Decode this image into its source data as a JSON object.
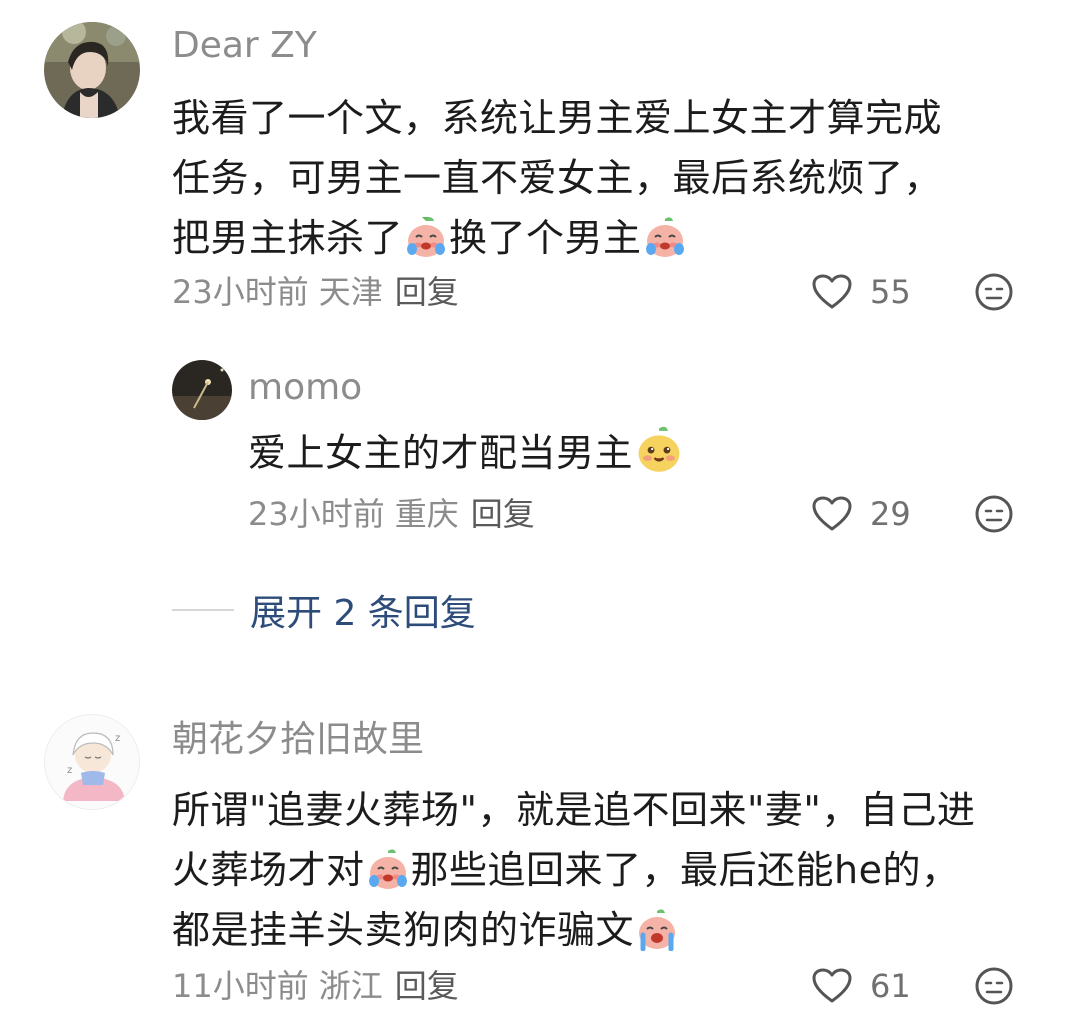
{
  "comments": [
    {
      "username": "Dear ZY",
      "lines": [
        "我看了一个文，系统让男主爱上女主才算完成",
        "任务，可男主一直不爱女主，最后系统烦了，"
      ],
      "line3_a": "把男主抹杀了",
      "line3_b": "换了个男主",
      "time": "23小时前",
      "location": "天津",
      "reply": "回复",
      "likes": "55"
    },
    {
      "username": "momo",
      "text": "爱上女主的才配当男主",
      "time": "23小时前",
      "location": "重庆",
      "reply": "回复",
      "likes": "29"
    },
    {
      "username": "朝花夕拾旧故里",
      "line1": "所谓\"追妻火葬场\"，就是追不回来\"妻\"，自己进",
      "line2_a": "火葬场才对",
      "line2_b": "那些追回来了，最后还能he的，",
      "line3": "都是挂羊头卖狗肉的诈骗文",
      "time": "11小时前",
      "location": "浙江",
      "reply": "回复",
      "likes": "61"
    }
  ],
  "expand_replies": "展开 2 条回复",
  "colors": {
    "meta": "#8c8c8c",
    "expand_link": "#2d4c7a",
    "text": "#1c1c1c"
  },
  "icons": [
    "heart-outline-icon",
    "dislike-face-icon",
    "crying-emoji",
    "happy-emoji"
  ]
}
